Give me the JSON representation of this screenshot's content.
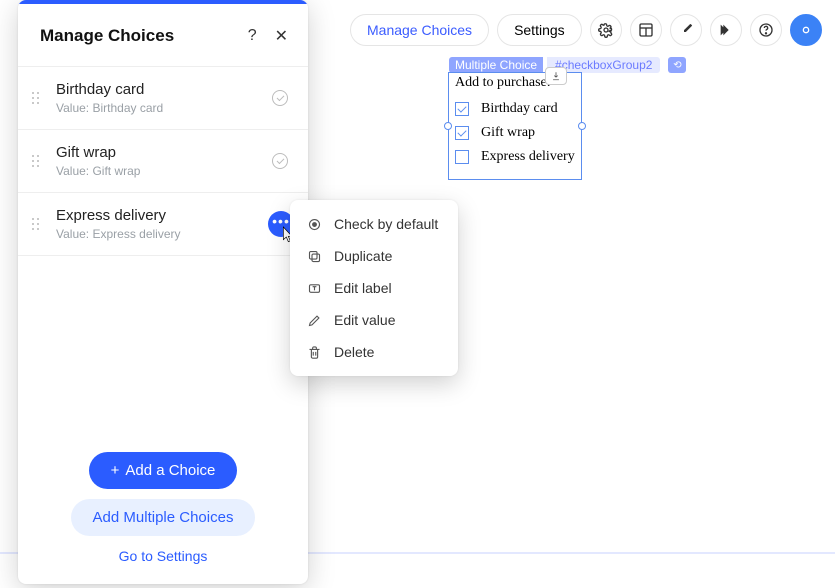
{
  "toolbar": {
    "manage_choices": "Manage Choices",
    "settings": "Settings"
  },
  "canvas": {
    "badge": "Multiple Choice",
    "id": "#checkboxGroup2",
    "title": "Add to purchase: *",
    "options": [
      {
        "label": "Birthday card",
        "checked": true
      },
      {
        "label": "Gift wrap",
        "checked": true
      },
      {
        "label": "Express delivery",
        "checked": false
      }
    ]
  },
  "panel": {
    "title": "Manage Choices",
    "choices": [
      {
        "title": "Birthday card",
        "value": "Value: Birthday card",
        "checked": true
      },
      {
        "title": "Gift wrap",
        "value": "Value: Gift wrap",
        "checked": true
      },
      {
        "title": "Express delivery",
        "value": "Value: Express delivery",
        "checked": false
      }
    ],
    "add_choice": "Add a Choice",
    "add_multiple": "Add Multiple Choices",
    "go_to_settings": "Go to Settings"
  },
  "ctx": {
    "check_default": "Check by default",
    "duplicate": "Duplicate",
    "edit_label": "Edit label",
    "edit_value": "Edit value",
    "delete": "Delete"
  }
}
